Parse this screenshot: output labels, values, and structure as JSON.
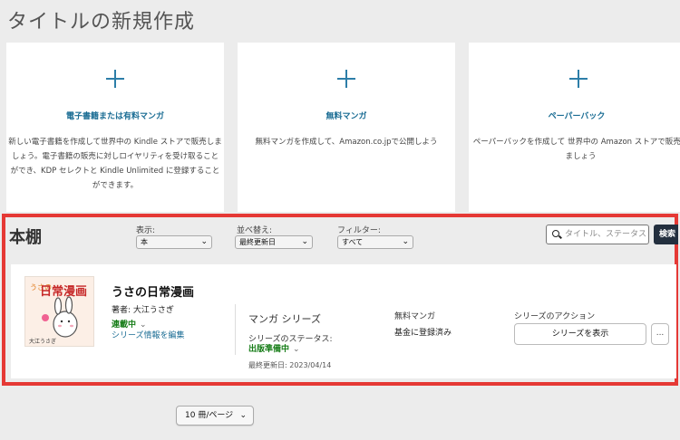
{
  "page": {
    "title": "タイトルの新規作成"
  },
  "cards": [
    {
      "title": "電子書籍または有料マンガ",
      "description": "新しい電子書籍を作成して世界中の Kindle ストアで販売しましょう。電子書籍の販売に対しロイヤリティを受け取ることができ、KDP セレクトと Kindle Unlimited に登録することができます。"
    },
    {
      "title": "無料マンガ",
      "description": "無料マンガを作成して、Amazon.co.jpで公開しよう"
    },
    {
      "title": "ペーパーバック",
      "description": "ペーパーバックを作成して 世界中の Amazon ストアで販売しましょう"
    }
  ],
  "shelf": {
    "title": "本棚",
    "display_label": "表示:",
    "display_value": "本",
    "sort_label": "並べ替え:",
    "sort_value": "最終更新日",
    "filter_label": "フィルター:",
    "filter_value": "すべて",
    "search_placeholder": "タイトル、ステータス",
    "search_button": "検索"
  },
  "item": {
    "cover_text_top": "うさの",
    "cover_title": "日常漫画",
    "cover_author": "大江うさぎ",
    "title": "うさの日常漫画",
    "author": "著者: 大江うさぎ",
    "status": "連載中",
    "edit_link": "シリーズ情報を編集",
    "series_type": "マンガ シリーズ",
    "series_status_label": "シリーズのステータス:",
    "series_status": "出版準備中",
    "last_updated": "最終更新日: 2023/04/14",
    "free_label": "無料マンガ",
    "free_value": "基金に登録済み",
    "actions_label": "シリーズのアクション",
    "show_series_button": "シリーズを表示",
    "more_button": "..."
  },
  "pagination": {
    "per_page": "10 冊/ページ"
  },
  "colors": {
    "accent": "#1b6d94",
    "status_green": "#157c16",
    "highlight_border": "#e53935",
    "search_button": "#232f3e"
  },
  "icons": {
    "card": "plus-icon",
    "search": "search-icon",
    "dropdown": "chevron-down-icon"
  }
}
